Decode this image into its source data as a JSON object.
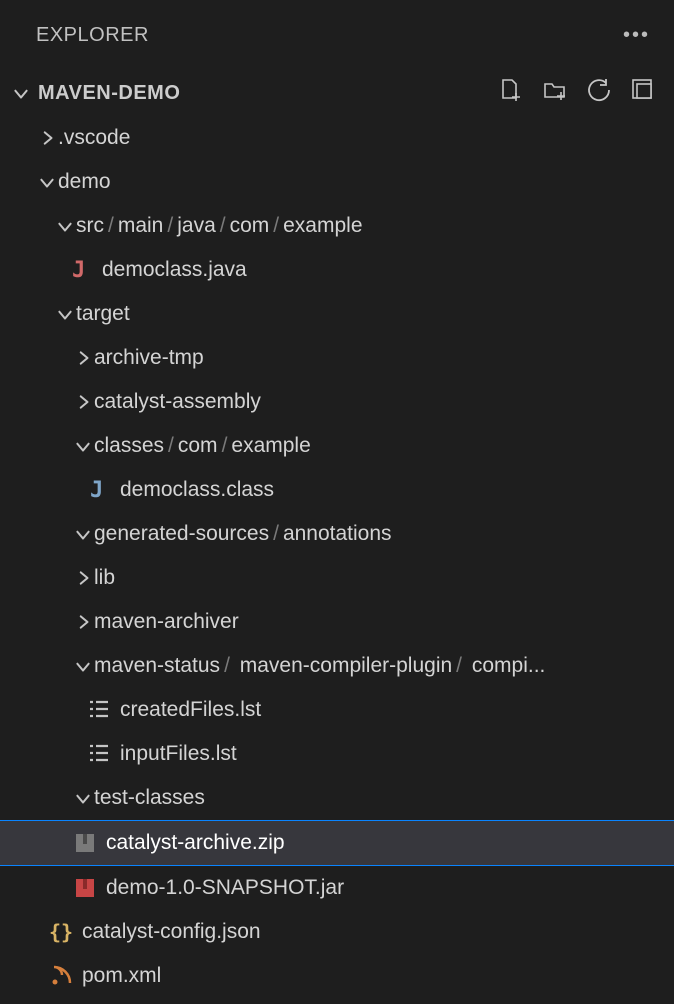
{
  "header": {
    "title": "EXPLORER"
  },
  "section": {
    "title": "MAVEN-DEMO"
  },
  "tree": {
    "vscode": ".vscode",
    "demo": "demo",
    "src": "src",
    "main": "main",
    "java": "java",
    "com": "com",
    "example": "example",
    "democlass_java": "democlass.java",
    "target": "target",
    "archive_tmp": "archive-tmp",
    "catalyst_assembly": "catalyst-assembly",
    "classes": "classes",
    "democlass_class": "democlass.class",
    "generated_sources": "generated-sources",
    "annotations": "annotations",
    "lib": "lib",
    "maven_archiver": "maven-archiver",
    "maven_status": "maven-status",
    "maven_compiler_plugin": "maven-compiler-plugin",
    "compi": "compi...",
    "createdFiles": "createdFiles.lst",
    "inputFiles": "inputFiles.lst",
    "test_classes": "test-classes",
    "catalyst_zip": "catalyst-archive.zip",
    "demo_jar": "demo-1.0-SNAPSHOT.jar",
    "catalyst_json": "catalyst-config.json",
    "pom": "pom.xml"
  }
}
